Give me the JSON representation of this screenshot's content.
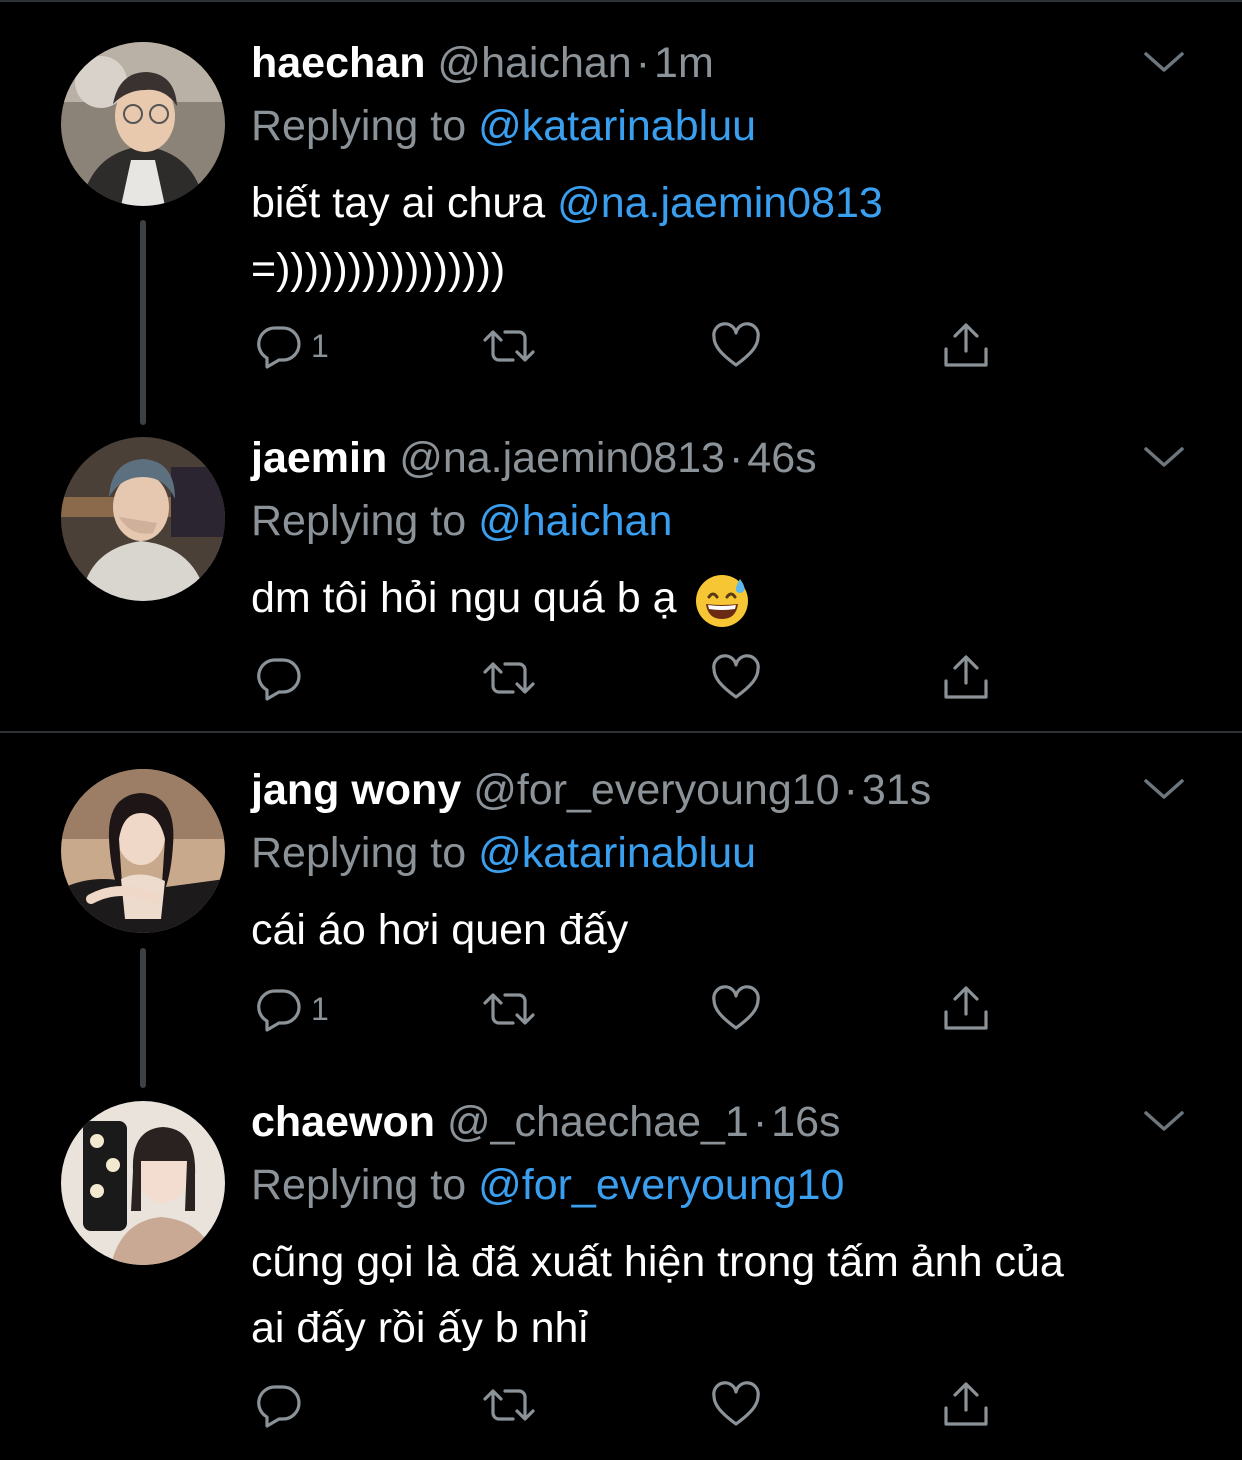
{
  "tweets": [
    {
      "name": "haechan",
      "handle": "@haichan",
      "time": "1m",
      "replying_prefix": "Replying to",
      "replying_to": "@katarinabluu",
      "line1_text": "biết tay ai chưa ",
      "line1_mention": "@na.jaemin0813",
      "line2_text": "=))))))))))))))))",
      "reply_count": "1",
      "avatar_icon": "avatar-photo"
    },
    {
      "name": "jaemin",
      "handle": "@na.jaemin0813",
      "time": "46s",
      "replying_prefix": "Replying to",
      "replying_to": "@haichan",
      "line1_text": "dm tôi hỏi ngu quá b ạ",
      "reply_count": "",
      "avatar_icon": "avatar-photo",
      "emoji_icon": "grinning-sweat-emoji"
    },
    {
      "name": "jang wony",
      "handle": "@for_everyoung10",
      "time": "31s",
      "replying_prefix": "Replying to",
      "replying_to": "@katarinabluu",
      "line1_text": "cái áo hơi quen đấy",
      "reply_count": "1",
      "avatar_icon": "avatar-photo"
    },
    {
      "name": "chaewon",
      "handle": "@_chaechae_1",
      "time": "16s",
      "replying_prefix": "Replying to",
      "replying_to": "@for_everyoung10",
      "line1_text": "cũng gọi là đã xuất hiện trong tấm ảnh của",
      "line2_text": "ai đấy rồi ấy b nhỉ",
      "reply_count": "",
      "avatar_icon": "avatar-photo"
    }
  ],
  "icons": {
    "reply": "reply-icon",
    "retweet": "retweet-icon",
    "like": "heart-icon",
    "share": "share-icon",
    "more": "chevron-down-icon"
  },
  "colors": {
    "background": "#000000",
    "name": "#ffffff",
    "secondary": "#8b9298",
    "mention": "#3b9ff0",
    "divider": "#2f3336"
  }
}
